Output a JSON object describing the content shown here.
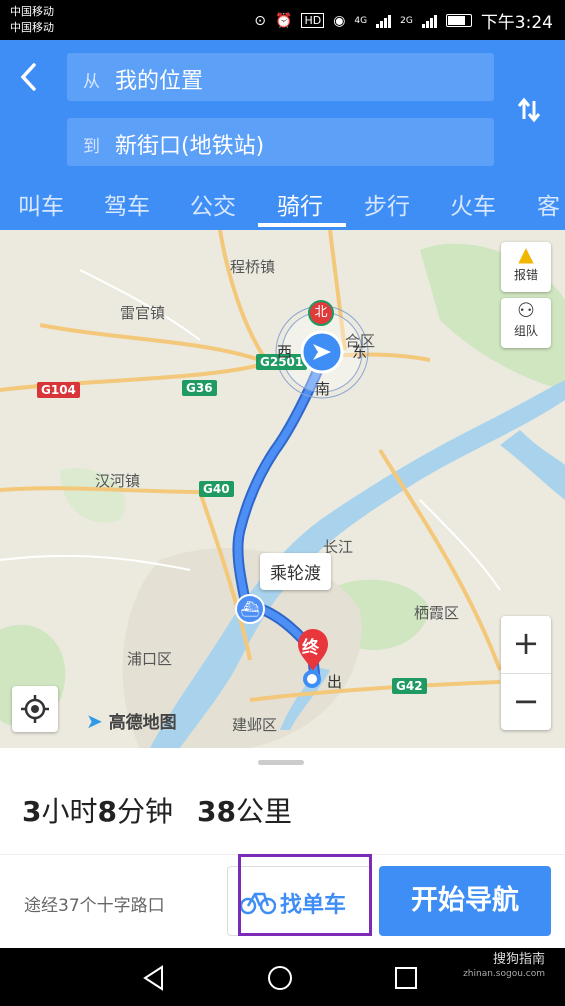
{
  "status_bar": {
    "carrier_1": "中国移动",
    "carrier_2": "中国移动",
    "network_hd": "HD",
    "signal_1": "4G",
    "signal_2": "2G",
    "time": "下午3:24"
  },
  "route_header": {
    "from_prefix": "从",
    "from_value": "我的位置",
    "to_prefix": "到",
    "to_value": "新街口(地铁站)"
  },
  "tabs": [
    {
      "label": "叫车"
    },
    {
      "label": "驾车"
    },
    {
      "label": "公交"
    },
    {
      "label": "骑行",
      "active": true
    },
    {
      "label": "步行"
    },
    {
      "label": "火车"
    },
    {
      "label": "客"
    }
  ],
  "map": {
    "labels": {
      "chengqiao": "程桥镇",
      "leiguan": "雷官镇",
      "hanhe": "汉河镇",
      "changjiang": "长江",
      "qixia": "栖霞区",
      "pukou": "浦口区",
      "jianye": "建邺区",
      "hehe": "合区"
    },
    "roads": {
      "g104": "G104",
      "g36": "G36",
      "g2501": "G2501",
      "g40": "G40",
      "g42": "G42"
    },
    "compass": {
      "north": "北",
      "west": "西",
      "east": "东",
      "south": "南"
    },
    "ferry_tip": "乘轮渡",
    "end_marker": "终",
    "exit_label": "出",
    "report_label": "报错",
    "group_label": "组队",
    "logo_text": "高德地图"
  },
  "summary": {
    "hours": "3",
    "hours_unit": "小时",
    "minutes": "8",
    "minutes_unit": "分钟",
    "distance": "38",
    "distance_unit": "公里"
  },
  "bottom": {
    "via_text": "途经37个十字路口",
    "bike_button": "找单车",
    "nav_button": "开始导航"
  },
  "watermark": {
    "line1": "搜狗指南",
    "line2": "zhinan.sogou.com"
  },
  "colors": {
    "accent": "#3f8ef6",
    "highlight_border": "#7b2bb5",
    "route": "#3b7de8"
  }
}
